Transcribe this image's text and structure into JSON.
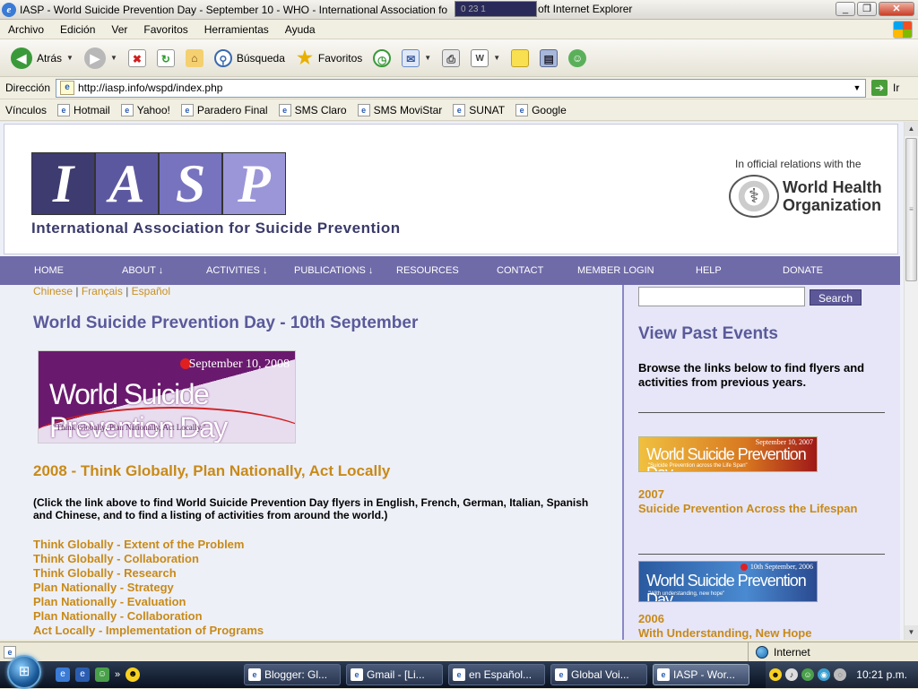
{
  "window": {
    "title": "IASP - World Suicide Prevention Day - September 10 - WHO - International Association fo",
    "title_tail": "oft Internet Explorer",
    "overlay_text": "0    23    1",
    "minimize": "_",
    "restore": "❐",
    "close": "✕"
  },
  "menu": [
    "Archivo",
    "Edición",
    "Ver",
    "Favoritos",
    "Herramientas",
    "Ayuda"
  ],
  "toolbar": {
    "back_label": "Atrás",
    "search_label": "Búsqueda",
    "favorites_label": "Favoritos"
  },
  "address": {
    "label": "Dirección",
    "url": "http://iasp.info/wspd/index.php",
    "go_label": "Ir"
  },
  "links": {
    "label": "Vínculos",
    "items": [
      "Hotmail",
      "Yahoo!",
      "Paradero Final",
      "SMS Claro",
      "SMS MoviStar",
      "SUNAT",
      "Google"
    ]
  },
  "header": {
    "logo_letters": [
      "I",
      "A",
      "S",
      "P"
    ],
    "org_name": "International Association for Suicide Prevention",
    "who_relation": "In official relations with the",
    "who_name_1": "World Health",
    "who_name_2": "Organization"
  },
  "nav": [
    "HOME",
    "ABOUT ↓",
    "ACTIVITIES ↓",
    "PUBLICATIONS ↓",
    "RESOURCES",
    "CONTACT",
    "MEMBER LOGIN",
    "HELP",
    "DONATE"
  ],
  "languages": [
    "Chinese",
    "Français",
    "Español"
  ],
  "main": {
    "title": "World Suicide Prevention Day - 10th September",
    "banner_date": "September 10, 2008",
    "banner_big": "World Suicide Prevention Day",
    "banner_tag": "\"Think Globally, Plan Nationally, Act Locally.\"",
    "subtitle": "2008 - Think Globally, Plan Nationally, Act Locally",
    "description": "(Click the link above to find World Suicide Prevention Day flyers in English, French, German, Italian, Spanish and Chinese, and to find a listing of activities from around the world.)",
    "toc": [
      "Think Globally - Extent of the Problem",
      "Think Globally - Collaboration",
      "Think Globally - Research",
      "Plan Nationally - Strategy",
      "Plan Nationally - Evaluation",
      "Plan Nationally - Collaboration",
      "Act Locally - Implementation of Programs"
    ]
  },
  "sidebar": {
    "search_button": "Search",
    "title": "View Past Events",
    "browse": "Browse the links below to find flyers and activities from previous years.",
    "e2007": {
      "date": "September 10, 2007",
      "big": "World Suicide Prevention Day",
      "tag": "\"Suicide Prevention across the Life Span\"",
      "year": "2007",
      "theme": "Suicide Prevention Across the Lifespan"
    },
    "e2006": {
      "date": "10th September, 2006",
      "big": "World Suicide Prevention Day",
      "tag": "\"With understanding, new hope\"",
      "year": "2006",
      "theme": "With Understanding, New Hope"
    }
  },
  "status": {
    "zone": "Internet"
  },
  "taskbar": {
    "tasks": [
      "Blogger: Gl...",
      "Gmail - [Li...",
      "en Español...",
      "Global Voi...",
      "IASP - Wor..."
    ],
    "clock": "10:21 p.m."
  }
}
